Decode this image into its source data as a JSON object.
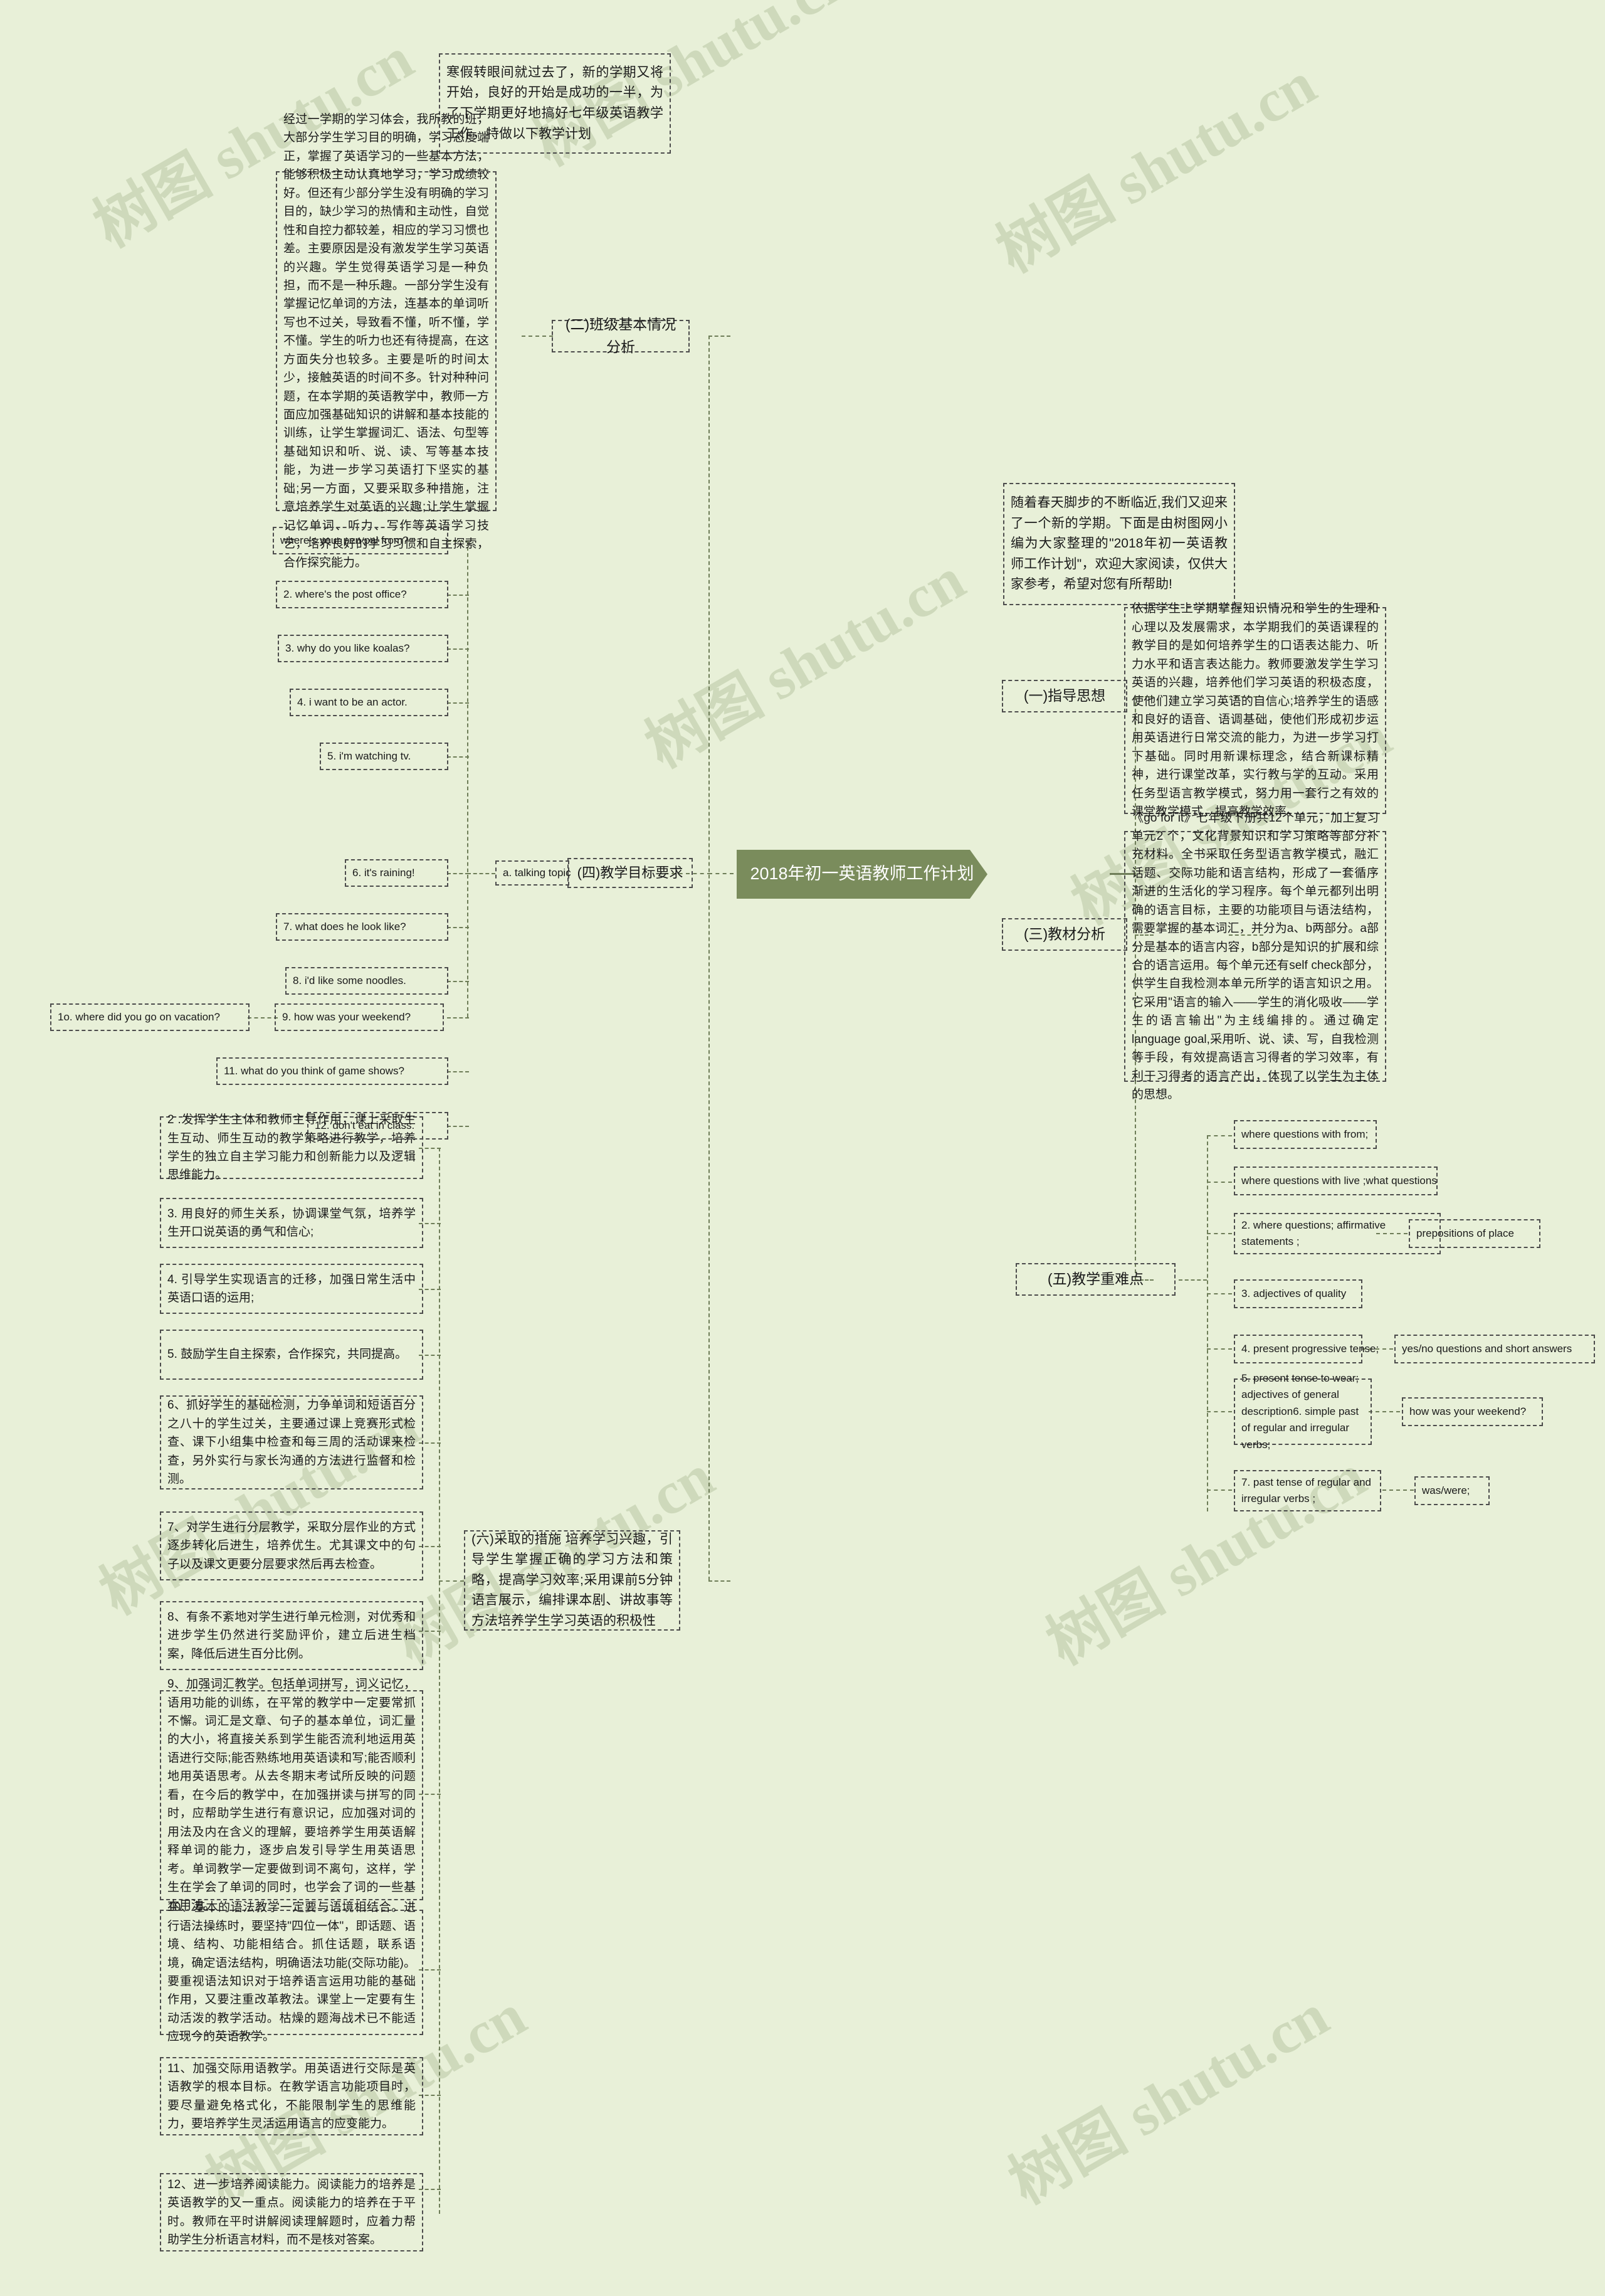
{
  "mindmap": {
    "root": "2018年初一英语教师工作计划",
    "intro_top": "寒假转眼间就过去了，新的学期又将开始，良好的开始是成功的一半，为了下学期更好地搞好七年级英语教学工作，特做以下教学计划",
    "intro_right": "随着春天脚步的不断临近,我们又迎来了一个新的学期。下面是由树图网小编为大家整理的\"2018年初一英语教师工作计划\"，欢迎大家阅读，仅供大家参考，希望对您有所帮助!",
    "branches": {
      "section2_label": "(二)班级基本情况分析",
      "section2_body": "经过一学期的学习体会，我所教的班，大部分学生学习目的明确，学习态度端正，掌握了英语学习的一些基本方法，能够积极主动认真地学习，学习成绩较好。但还有少部分学生没有明确的学习目的，缺少学习的热情和主动性，自觉性和自控力都较差，相应的学习习惯也差。主要原因是没有激发学生学习英语的兴趣。学生觉得英语学习是一种负担，而不是一种乐趣。一部分学生没有掌握记忆单词的方法，连基本的单词听写也不过关，导致看不懂，听不懂，学不懂。学生的听力也还有待提高，在这方面失分也较多。主要是听的时间太少，接触英语的时间不多。针对种种问题，在本学期的英语教学中，教师一方面应加强基础知识的讲解和基本技能的训练，让学生掌握词汇、语法、句型等基础知识和听、说、读、写等基本技能，为进一步学习英语打下坚实的基础;另一方面，又要采取多种措施，注意培养学生对英语的兴趣;让学生掌握记忆单词、听力、写作等英语学习技艺，培养良好的学习习惯和自主探索，合作探究能力。",
      "section1_label": "(一)指导思想",
      "section1_body": "依据学生上学期掌握知识情况和学生的生理和心理以及发展需求，本学期我们的英语课程的教学目的是如何培养学生的口语表达能力、听力水平和语言表达能力。教师要激发学生学习英语的兴趣，培养他们学习英语的积极态度，使他们建立学习英语的自信心;培养学生的语感和良好的语音、语调基础，使他们形成初步运用英语进行日常交流的能力，为进一步学习打下基础。同时用新课标理念，结合新课标精神，进行课堂改革，实行教与学的互动。采用任务型语言教学模式，努力用一套行之有效的课堂教学模式，提高教学效率。",
      "section3_label": "(三)教材分析",
      "section3_body": "《go for it》七年级下册共12个单元，加上复习单元2 个，文化背景知识和学习策略等部分补充材料。全书采取任务型语言教学模式，融汇话题、交际功能和语言结构，形成了一套循序渐进的生活化的学习程序。每个单元都列出明确的语言目标，主要的功能项目与语法结构，需要掌握的基本词汇，并分为a、b两部分。a部分是基本的语言内容，b部分是知识的扩展和综合的语言运用。每个单元还有self check部分，供学生自我检测本单元所学的语言知识之用。它采用\"语言的输入——学生的消化吸收——学生的语言输出\"为主线编排的。通过确定language goal,采用听、说、读、写，自我检测等手段，有效提高语言习得者的学习效率，有利于习得者的语言产出，体现了以学生为主体的思想。",
      "section4_label": "(四)教学目标要求",
      "section4_sub": "a. talking topic",
      "topics": [
        "where's your pen pal from?",
        "2. where's the post office?",
        "3. why do you like koalas?",
        "4. i want to be an actor.",
        "5. i'm watching tv.",
        "6. it's raining!",
        "7. what does he look like?",
        "8. i'd like some noodles.",
        "9. how was your weekend?",
        "1o. where did you go on vacation?",
        "11. what do you think of game shows?",
        "12. don't eat in class."
      ],
      "section5_label": "(五)教学重难点",
      "keypoints": [
        {
          "text": "where questions with from;",
          "child": null
        },
        {
          "text": "where questions with live ;what questions",
          "child": null
        },
        {
          "text": "2. where questions; affirmative statements ;",
          "child": "prepositions of place"
        },
        {
          "text": "3. adjectives of quality",
          "child": null
        },
        {
          "text": "4. present progressive tense;",
          "child": "yes/no questions and short answers"
        },
        {
          "text": "5. present tense to wear; adjectives of general description6. simple past of regular and irregular verbs;",
          "child": "how was your weekend?"
        },
        {
          "text": "7. past tense of regular and irregular verbs ;",
          "child": "was/were;"
        }
      ],
      "section6_label": "(六)采取的措施 培养学习兴趣，引导学生掌握正确的学习方法和策略，提高学习效率;采用课前5分钟语言展示，编排课本剧、讲故事等方法培养学生学习英语的积极性",
      "measures": [
        "2 .发挥学生主体和教师主导作用，课上采取生生互动、师生互动的教学策略进行教学，培养学生的独立自主学习能力和创新能力以及逻辑思维能力。",
        "3. 用良好的师生关系，协调课堂气氛，培养学生开口说英语的勇气和信心;",
        "4. 引导学生实现语言的迁移，加强日常生活中英语口语的运用;",
        "5. 鼓励学生自主探索，合作探究，共同提高。",
        "6、抓好学生的基础检测，力争单词和短语百分之八十的学生过关，主要通过课上竞赛形式检查、课下小组集中检查和每三周的活动课来检查，另外实行与家长沟通的方法进行监督和检测。",
        "7、对学生进行分层教学，采取分层作业的方式逐步转化后进生，培养优生。尤其课文中的句子以及课文更要分层要求然后再去检查。",
        "8、有条不紊地对学生进行单元检测，对优秀和进步学生仍然进行奖励评价，建立后进生档案，降低后进生百分比例。",
        "9、加强词汇教学。包括单词拼写，词义记忆，语用功能的训练，在平常的教学中一定要常抓不懈。词汇是文章、句子的基本单位，词汇量的大小，将直接关系到学生能否流利地运用英语进行交际;能否熟练地用英语读和写;能否顺利地用英语思考。从去冬期末考试所反映的问题看，在今后的教学中，在加强拼读与拼写的同时，应帮助学生进行有意识记，应加强对词的用法及内在含义的理解，要培养学生用英语解释单词的能力，逐步启发引导学生用英语思考。单词教学一定要做到词不离句，这样，学生在学会了单词的同时，也学会了词的一些基本用法。",
        "10、基本的语法教学一定要与语境相结合。进行语法操练时，要坚持\"四位一体\"，即话题、语境、结构、功能相结合。抓住话题，联系语境，确定语法结构，明确语法功能(交际功能)。要重视语法知识对于培养语言运用功能的基础作用，又要注重改革教法。课堂上一定要有生动活泼的教学活动。枯燥的题海战术已不能适应现今的英语教学。",
        "11、加强交际用语教学。用英语进行交际是英语教学的根本目标。在教学语言功能项目时，要尽量避免格式化，不能限制学生的思维能力，要培养学生灵活运用语言的应变能力。",
        "12、进一步培养阅读能力。阅读能力的培养是英语教学的又一重点。阅读能力的培养在于平时。教师在平时讲解阅读理解题时，应着力帮助学生分析语言材料，而不是核对答案。"
      ]
    },
    "watermarks": [
      "树图 shutu.cn",
      "树图 shutu.cn",
      "树图 shutu.cn",
      "树图 shutu.cn",
      "树图 shutu.cn",
      "树图 shutu.cn",
      "树图 shutu.cn"
    ],
    "colors": {
      "background": "#e8f0d8",
      "root_fill": "#7a8c5c",
      "root_text": "#ffffff",
      "border": "#4c4c4c",
      "connector": "#6e7d58"
    }
  }
}
